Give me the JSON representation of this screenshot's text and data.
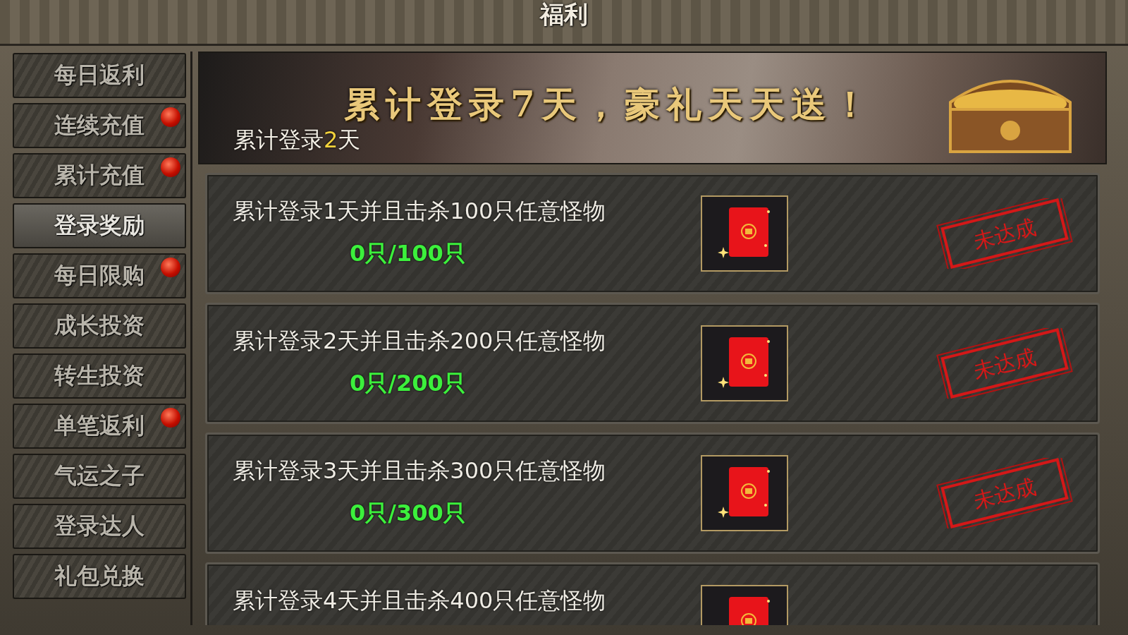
{
  "window": {
    "title": "福利"
  },
  "sidebar": {
    "items": [
      {
        "label": "每日返利",
        "selected": false,
        "dot": false
      },
      {
        "label": "连续充值",
        "selected": false,
        "dot": true
      },
      {
        "label": "累计充值",
        "selected": false,
        "dot": true
      },
      {
        "label": "登录奖励",
        "selected": true,
        "dot": false
      },
      {
        "label": "每日限购",
        "selected": false,
        "dot": true
      },
      {
        "label": "成长投资",
        "selected": false,
        "dot": false
      },
      {
        "label": "转生投资",
        "selected": false,
        "dot": false
      },
      {
        "label": "单笔返利",
        "selected": false,
        "dot": true
      },
      {
        "label": "气运之子",
        "selected": false,
        "dot": false
      },
      {
        "label": "登录达人",
        "selected": false,
        "dot": false
      },
      {
        "label": "礼包兑换",
        "selected": false,
        "dot": false
      }
    ]
  },
  "banner": {
    "title": "累计登录7天，豪礼天天送！",
    "login_count": {
      "before": "累计登录",
      "value": "2",
      "after": "天"
    }
  },
  "tasks": [
    {
      "name": "累计登录1天并且击杀100只任意怪物",
      "progress": "0只/100只",
      "status": "未达成"
    },
    {
      "name": "累计登录2天并且击杀200只任意怪物",
      "progress": "0只/200只",
      "status": "未达成"
    },
    {
      "name": "累计登录3天并且击杀300只任意怪物",
      "progress": "0只/300只",
      "status": "未达成"
    },
    {
      "name": "累计登录4天并且击杀400只任意怪物"
    }
  ]
}
